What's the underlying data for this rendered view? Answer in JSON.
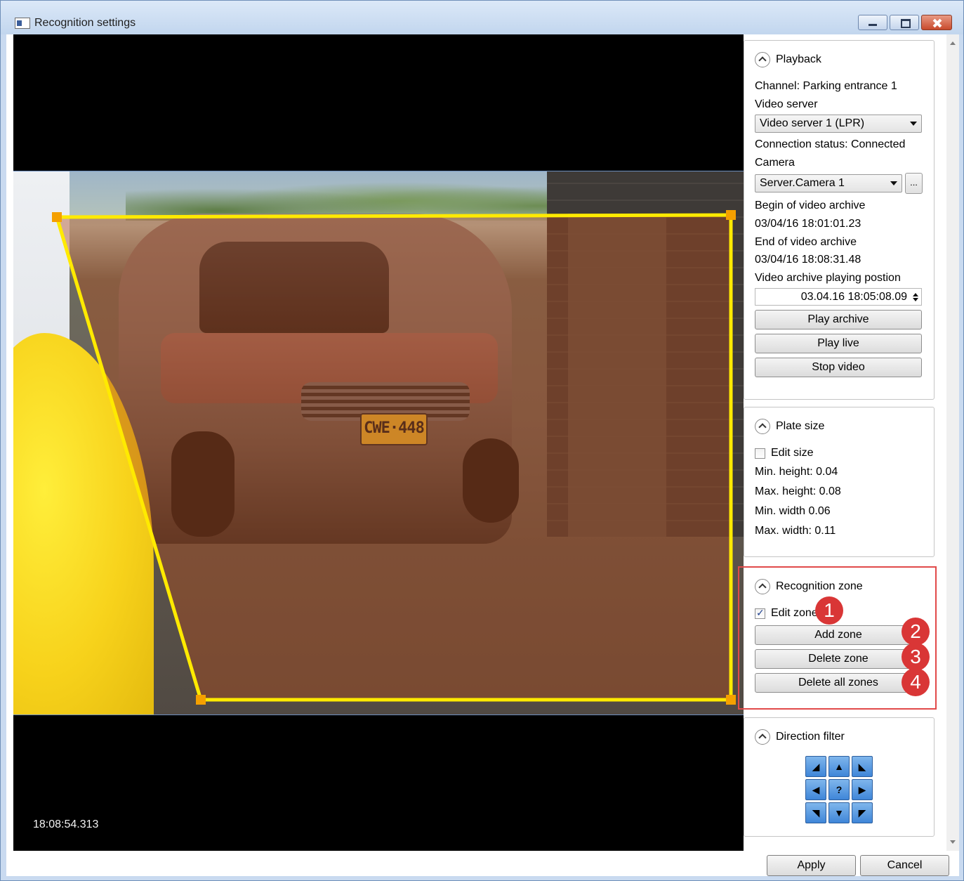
{
  "window": {
    "title": "Recognition settings"
  },
  "video": {
    "timestamp": "18:08:54.313",
    "plate_text": "CWE·448"
  },
  "playback": {
    "title": "Playback",
    "channel": "Channel: Parking entrance 1",
    "video_server_label": "Video server",
    "video_server_value": "Video server 1 (LPR)",
    "connection_status": "Connection status: Connected",
    "camera_label": "Camera",
    "camera_value": "Server.Camera 1",
    "camera_more": "...",
    "begin_label": "Begin of video archive",
    "begin_value": "03/04/16 18:01:01.23",
    "end_label": "End of video archive",
    "end_value": "03/04/16 18:08:31.48",
    "position_label": "Video archive playing postion",
    "position_value": "03.04.16 18:05:08.09",
    "play_archive": "Play archive",
    "play_live": "Play live",
    "stop_video": "Stop video"
  },
  "plate_size": {
    "title": "Plate size",
    "edit_size": "Edit size",
    "edit_size_checked": false,
    "min_height": "Min. height: 0.04",
    "max_height": "Max. height: 0.08",
    "min_width": "Min. width 0.06",
    "max_width": "Max. width: 0.11"
  },
  "recognition_zone": {
    "title": "Recognition zone",
    "edit_zone": "Edit zone",
    "edit_zone_checked": true,
    "add_zone": "Add zone",
    "delete_zone": "Delete zone",
    "delete_all_zones": "Delete all zones",
    "markers": [
      "1",
      "2",
      "3",
      "4"
    ]
  },
  "direction_filter": {
    "title": "Direction filter",
    "center_label": "?"
  },
  "footer": {
    "apply": "Apply",
    "cancel": "Cancel"
  },
  "colors": {
    "zone_outline": "#ffea00",
    "zone_fill": "#b04a1a",
    "zone_handle": "#f5a000",
    "annotation_red": "#d93636"
  }
}
